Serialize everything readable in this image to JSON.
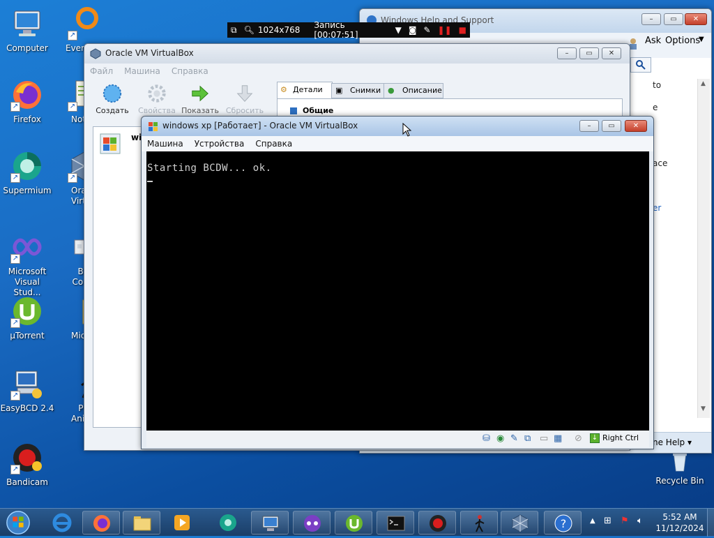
{
  "desktop": {
    "icons": [
      {
        "label": "Computer",
        "icon": "computer-icon"
      },
      {
        "label": "Everything",
        "icon": "everything-icon"
      },
      {
        "label": "Firefox",
        "icon": "firefox-icon"
      },
      {
        "label": "Notepad++",
        "icon": "notepad-icon"
      },
      {
        "label": "Supermium",
        "icon": "supermium-icon"
      },
      {
        "label": "Oracle VirtualBox",
        "icon": "virtualbox-icon"
      },
      {
        "label": "Microsoft Visual Stud...",
        "icon": "visual-studio-icon"
      },
      {
        "label": "Blo Comp",
        "icon": "blocks-icon"
      },
      {
        "label": "µTorrent",
        "icon": "utorrent-icon"
      },
      {
        "label": "Micros",
        "icon": "folder-icon"
      },
      {
        "label": "EasyBCD 2.4",
        "icon": "easybcd-icon"
      },
      {
        "label": "Piv Anima",
        "icon": "pivot-icon"
      },
      {
        "label": "Bandicam",
        "icon": "bandicam-icon"
      },
      {
        "label": "Recycle Bin",
        "icon": "recycle-bin-icon"
      }
    ]
  },
  "recorder": {
    "resolution": "1024x768",
    "recording": "Запись [00:07:51]"
  },
  "help_window": {
    "title": "Windows Help and Support",
    "ask": "Ask",
    "options": "Options",
    "side_fragments": [
      "to",
      "e",
      "ace",
      "er"
    ],
    "help_link": "ne Help"
  },
  "vbox_manager": {
    "title": "Oracle VM VirtualBox",
    "menu": [
      "Файл",
      "Машина",
      "Справка"
    ],
    "toolbar": [
      "Создать",
      "Свойства",
      "Показать",
      "Сбросить"
    ],
    "tabs": [
      "Детали",
      "Снимки",
      "Описание"
    ],
    "section": "Общие",
    "vm_item": "wi"
  },
  "vm_window": {
    "title": "windows xp [Работает] - Oracle VM VirtualBox",
    "menu": [
      "Машина",
      "Устройства",
      "Справка"
    ],
    "console_line": "Starting BCDW... ok.",
    "host_key": "Right Ctrl"
  },
  "taskbar": {
    "time": "5:52 AM",
    "date": "11/12/2024"
  },
  "colors": {
    "desktop": "#1a6cc4",
    "console_bg": "#000000",
    "console_fg": "#d0d0d0",
    "recorder_bg": "#0d0d0d",
    "close_red": "#c4402b"
  }
}
